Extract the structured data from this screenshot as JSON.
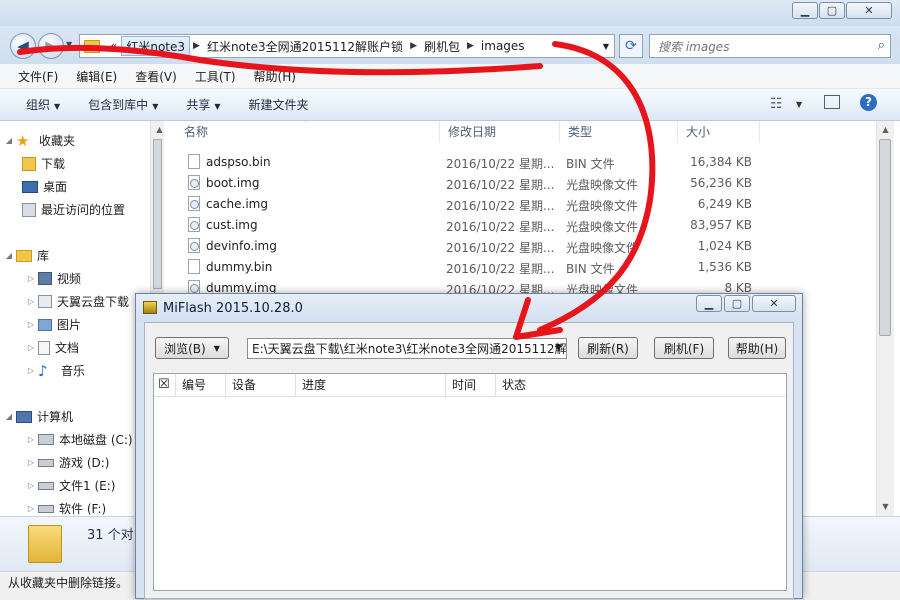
{
  "explorer": {
    "breadcrumb": [
      "«",
      "红米note3",
      "红米note3全网通2015112解账户锁",
      "刷机包",
      "images"
    ],
    "search_placeholder": "搜索 images",
    "menu": [
      "文件(F)",
      "编辑(E)",
      "查看(V)",
      "工具(T)",
      "帮助(H)"
    ],
    "toolbar": [
      "组织",
      "包含到库中",
      "共享",
      "新建文件夹"
    ],
    "nav": {
      "favorites": "收藏夹",
      "downloads": "下载",
      "desktop": "桌面",
      "recent": "最近访问的位置",
      "libraries": "库",
      "videos": "视频",
      "tianyi": "天翼云盘下载",
      "pictures": "图片",
      "documents": "文档",
      "music": "音乐",
      "computer": "计算机",
      "drive_c": "本地磁盘 (C:)",
      "drive_d": "游戏 (D:)",
      "drive_e": "文件1 (E:)",
      "drive_f": "软件 (F:)"
    },
    "columns": {
      "name": "名称",
      "date": "修改日期",
      "type": "类型",
      "size": "大小"
    },
    "files": [
      {
        "name": "adspso.bin",
        "date": "2016/10/22 星期...",
        "type": "BIN 文件",
        "size": "16,384 KB"
      },
      {
        "name": "boot.img",
        "date": "2016/10/22 星期...",
        "type": "光盘映像文件",
        "size": "56,236 KB"
      },
      {
        "name": "cache.img",
        "date": "2016/10/22 星期...",
        "type": "光盘映像文件",
        "size": "6,249 KB"
      },
      {
        "name": "cust.img",
        "date": "2016/10/22 星期...",
        "type": "光盘映像文件",
        "size": "83,957 KB"
      },
      {
        "name": "devinfo.img",
        "date": "2016/10/22 星期...",
        "type": "光盘映像文件",
        "size": "1,024 KB"
      },
      {
        "name": "dummy.bin",
        "date": "2016/10/22 星期...",
        "type": "BIN 文件",
        "size": "1,536 KB"
      },
      {
        "name": "dummy.img",
        "date": "2016/10/22 星期...",
        "type": "光盘映像文件",
        "size": "8 KB"
      }
    ],
    "details_count": "31 个对",
    "status_text": "从收藏夹中删除链接。"
  },
  "miflash": {
    "title": "MiFlash 2015.10.28.0",
    "browse_label": "浏览(B)",
    "path_value": "E:\\天翼云盘下载\\红米note3\\红米note3全网通2015112解",
    "refresh_label": "刷新(R)",
    "flash_label": "刷机(F)",
    "help_label": "帮助(H)",
    "columns": [
      "编号",
      "设备",
      "进度",
      "时间",
      "状态"
    ],
    "header_checkbox": "☒"
  },
  "colors": {
    "annotation": "#e8141b",
    "accent": "#2b6cc4"
  }
}
